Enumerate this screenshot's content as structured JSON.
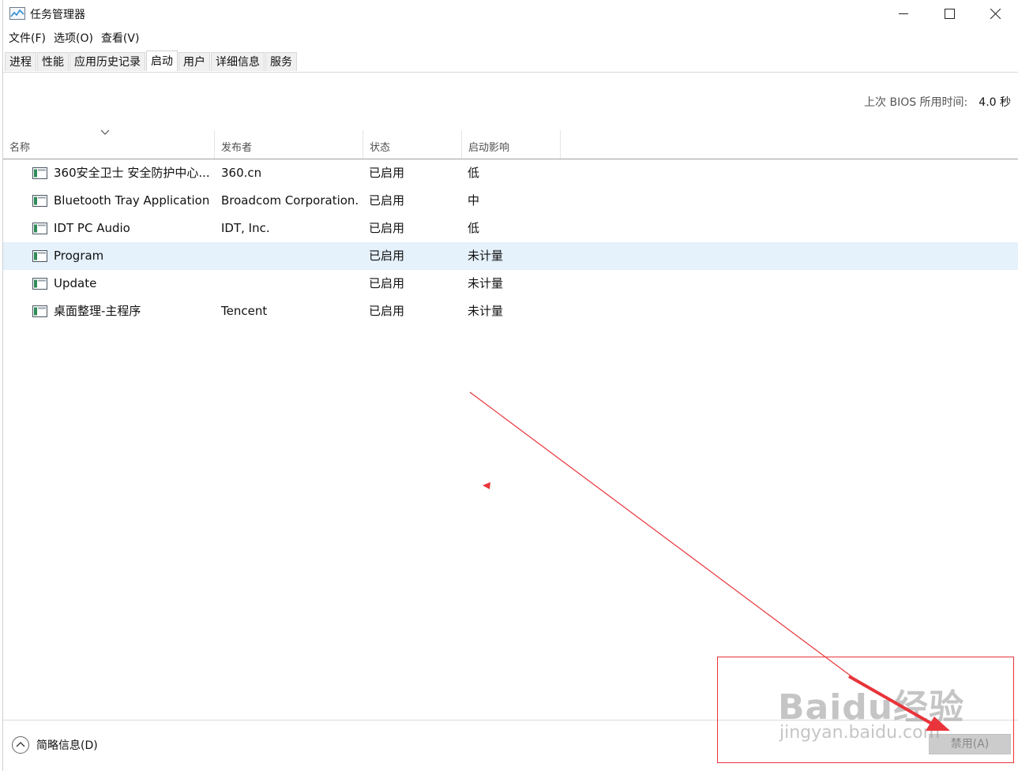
{
  "window": {
    "title": "任务管理器"
  },
  "menu": [
    "文件(F)",
    "选项(O)",
    "查看(V)"
  ],
  "tabs": [
    "进程",
    "性能",
    "应用历史记录",
    "启动",
    "用户",
    "详细信息",
    "服务"
  ],
  "active_tab": "启动",
  "bios": {
    "label": "上次 BIOS 所用时间:",
    "value": "4.0 秒"
  },
  "columns": [
    "名称",
    "发布者",
    "状态",
    "启动影响"
  ],
  "rows": [
    {
      "name": "360安全卫士 安全防护中心...",
      "publisher": "360.cn",
      "status": "已启用",
      "impact": "低"
    },
    {
      "name": "Bluetooth Tray Application",
      "publisher": "Broadcom Corporation.",
      "status": "已启用",
      "impact": "中"
    },
    {
      "name": "IDT PC Audio",
      "publisher": "IDT, Inc.",
      "status": "已启用",
      "impact": "低"
    },
    {
      "name": "Program",
      "publisher": "",
      "status": "已启用",
      "impact": "未计量"
    },
    {
      "name": "Update",
      "publisher": "",
      "status": "已启用",
      "impact": "未计量"
    },
    {
      "name": "桌面整理-主程序",
      "publisher": "Tencent",
      "status": "已启用",
      "impact": "未计量"
    }
  ],
  "selected_row": "Program",
  "footer": {
    "fewer_details": "简略信息(D)",
    "disable_button": "禁用(A)"
  },
  "watermark": {
    "brand": "Baidu经验",
    "url": "jingyan.baidu.com"
  },
  "colors": {
    "selection": "#e5f1fb",
    "annotation": "#e8343a"
  }
}
